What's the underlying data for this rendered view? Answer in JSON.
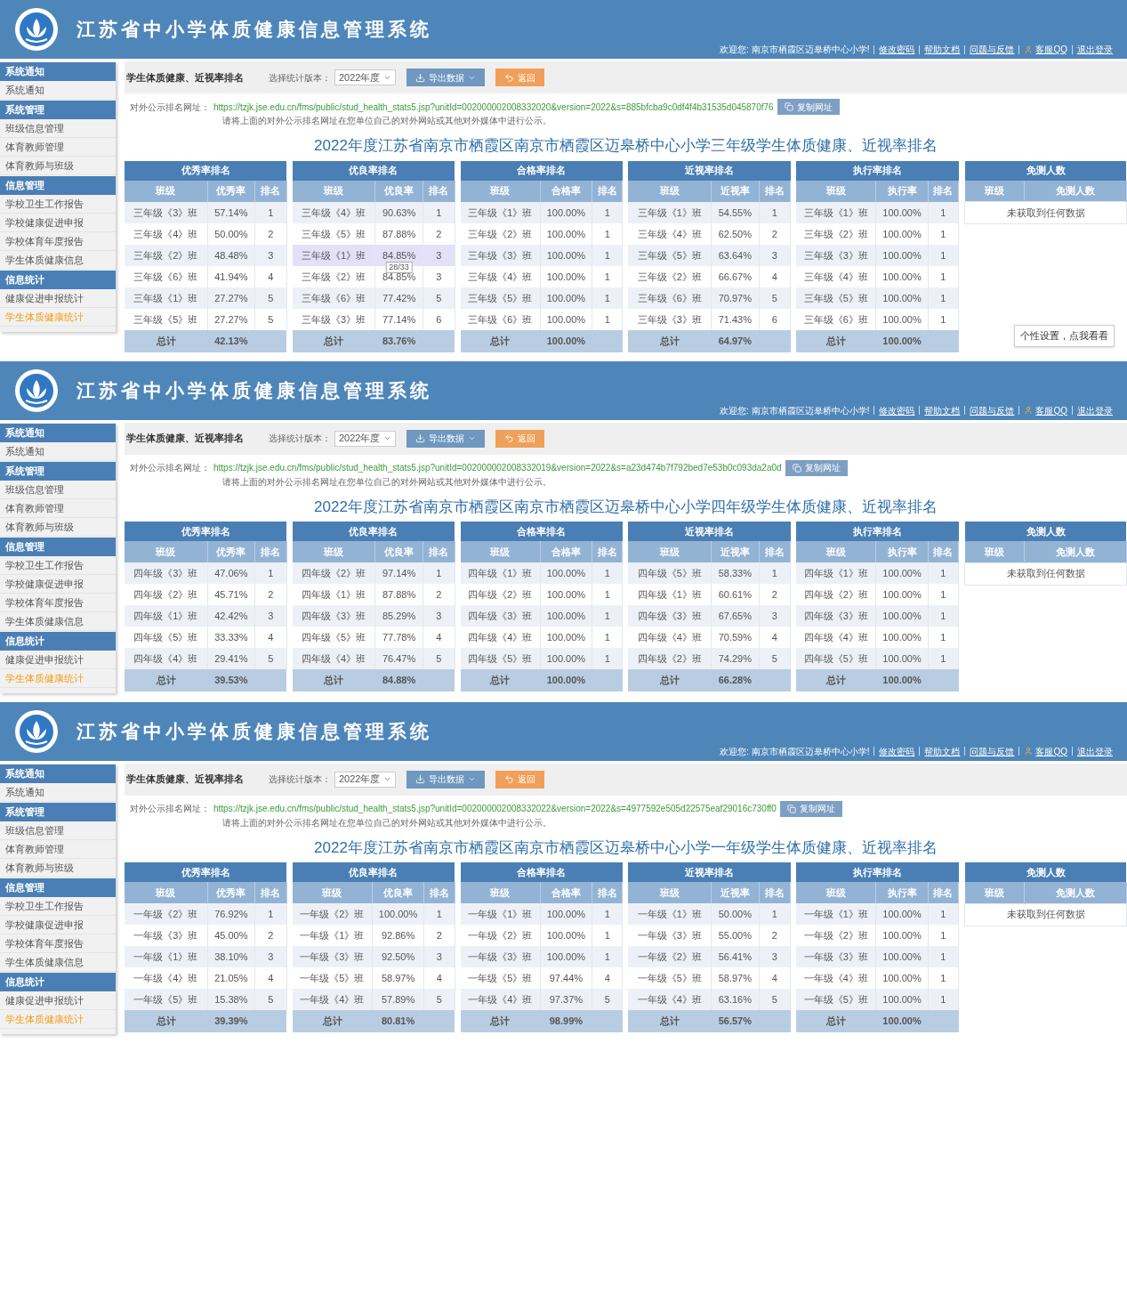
{
  "screens": [
    {
      "header": {
        "title": "江苏省中小学体质健康信息管理系统",
        "welcome": "欢迎您: 南京市栖霞区迈皋桥中心小学!",
        "links": [
          "修改密码",
          "帮助文档",
          "问题与反馈",
          "客服QQ",
          "退出登录"
        ]
      },
      "sidebar": [
        {
          "label": "系统通知",
          "items": [
            {
              "label": "系统通知",
              "selected": false
            }
          ]
        },
        {
          "label": "系统管理",
          "items": [
            {
              "label": "班级信息管理",
              "selected": false
            },
            {
              "label": "体育教师管理",
              "selected": false
            },
            {
              "label": "体育教师与班级",
              "selected": false
            }
          ]
        },
        {
          "label": "信息管理",
          "items": [
            {
              "label": "学校卫生工作报告",
              "selected": false
            },
            {
              "label": "学校健康促进申报",
              "selected": false
            },
            {
              "label": "学校体育年度报告",
              "selected": false
            },
            {
              "label": "学生体质健康信息",
              "selected": false
            }
          ]
        },
        {
          "label": "信息统计",
          "items": [
            {
              "label": "健康促进申报统计",
              "selected": false
            },
            {
              "label": "学生体质健康统计",
              "selected": true
            }
          ]
        }
      ],
      "toolbar": {
        "title": "学生体质健康、近视率排名",
        "version_label": "选择统计版本：",
        "version": "2022年度",
        "buttons": [
          {
            "kind": "export",
            "label": "导出数据"
          },
          {
            "kind": "back",
            "label": "返回"
          }
        ]
      },
      "url_label": "对外公示排名网址：",
      "url": "https://tzjk.jse.edu.cn/fms/public/stud_health_stats5.jsp?unitId=002000002008332020&version=2022&s=885bfcba9c0df4f4b31535d045870f76",
      "copy_button": "复制网址",
      "note": "请将上面的对外公示排名网址在您单位自己的对外网站或其他对外媒体中进行公示。",
      "heading": "2022年度江苏省南京市栖霞区南京市栖霞区迈皋桥中心小学三年级学生体质健康、近视率排名",
      "tables": [
        {
          "title": "优秀率排名",
          "columns": [
            "班级",
            "优秀率",
            "排名"
          ],
          "rows": [
            {
              "cells": [
                "三年级《3》班",
                "57.14%",
                "1"
              ],
              "hovered": false
            },
            {
              "cells": [
                "三年级《4》班",
                "50.00%",
                "2"
              ],
              "hovered": false
            },
            {
              "cells": [
                "三年级《2》班",
                "48.48%",
                "3"
              ],
              "hovered": false
            },
            {
              "cells": [
                "三年级《6》班",
                "41.94%",
                "4"
              ],
              "hovered": false
            },
            {
              "cells": [
                "三年级《1》班",
                "27.27%",
                "5"
              ],
              "hovered": false
            },
            {
              "cells": [
                "三年级《5》班",
                "27.27%",
                "5"
              ],
              "hovered": false
            }
          ],
          "total": [
            "总计",
            "42.13%"
          ]
        },
        {
          "title": "优良率排名",
          "columns": [
            "班级",
            "优良率",
            "排名"
          ],
          "rows": [
            {
              "cells": [
                "三年级《4》班",
                "90.63%",
                "1"
              ],
              "hovered": false
            },
            {
              "cells": [
                "三年级《5》班",
                "87.88%",
                "2"
              ],
              "hovered": false
            },
            {
              "cells": [
                "三年级《1》班",
                "84.85%",
                "3"
              ],
              "hovered": true,
              "tooltip": "28/33"
            },
            {
              "cells": [
                "三年级《2》班",
                "84.85%",
                "3"
              ],
              "hovered": false
            },
            {
              "cells": [
                "三年级《6》班",
                "77.42%",
                "5"
              ],
              "hovered": false
            },
            {
              "cells": [
                "三年级《3》班",
                "77.14%",
                "6"
              ],
              "hovered": false
            }
          ],
          "total": [
            "总计",
            "83.76%"
          ]
        },
        {
          "title": "合格率排名",
          "columns": [
            "班级",
            "合格率",
            "排名"
          ],
          "rows": [
            {
              "cells": [
                "三年级《1》班",
                "100.00%",
                "1"
              ],
              "hovered": false
            },
            {
              "cells": [
                "三年级《2》班",
                "100.00%",
                "1"
              ],
              "hovered": false
            },
            {
              "cells": [
                "三年级《3》班",
                "100.00%",
                "1"
              ],
              "hovered": false
            },
            {
              "cells": [
                "三年级《4》班",
                "100.00%",
                "1"
              ],
              "hovered": false
            },
            {
              "cells": [
                "三年级《5》班",
                "100.00%",
                "1"
              ],
              "hovered": false
            },
            {
              "cells": [
                "三年级《6》班",
                "100.00%",
                "1"
              ],
              "hovered": false
            }
          ],
          "total": [
            "总计",
            "100.00%"
          ]
        },
        {
          "title": "近视率排名",
          "columns": [
            "班级",
            "近视率",
            "排名"
          ],
          "rows": [
            {
              "cells": [
                "三年级《1》班",
                "54.55%",
                "1"
              ],
              "hovered": false
            },
            {
              "cells": [
                "三年级《4》班",
                "62.50%",
                "2"
              ],
              "hovered": false
            },
            {
              "cells": [
                "三年级《5》班",
                "63.64%",
                "3"
              ],
              "hovered": false
            },
            {
              "cells": [
                "三年级《2》班",
                "66.67%",
                "4"
              ],
              "hovered": false
            },
            {
              "cells": [
                "三年级《6》班",
                "70.97%",
                "5"
              ],
              "hovered": false
            },
            {
              "cells": [
                "三年级《3》班",
                "71.43%",
                "6"
              ],
              "hovered": false
            }
          ],
          "total": [
            "总计",
            "64.97%"
          ]
        },
        {
          "title": "执行率排名",
          "columns": [
            "班级",
            "执行率",
            "排名"
          ],
          "rows": [
            {
              "cells": [
                "三年级《1》班",
                "100.00%",
                "1"
              ],
              "hovered": false
            },
            {
              "cells": [
                "三年级《2》班",
                "100.00%",
                "1"
              ],
              "hovered": false
            },
            {
              "cells": [
                "三年级《3》班",
                "100.00%",
                "1"
              ],
              "hovered": false
            },
            {
              "cells": [
                "三年级《4》班",
                "100.00%",
                "1"
              ],
              "hovered": false
            },
            {
              "cells": [
                "三年级《5》班",
                "100.00%",
                "1"
              ],
              "hovered": false
            },
            {
              "cells": [
                "三年级《6》班",
                "100.00%",
                "1"
              ],
              "hovered": false
            }
          ],
          "total": [
            "总计",
            "100.00%"
          ]
        },
        {
          "title": "免测人数",
          "columns": [
            "班级",
            "免测人数"
          ],
          "empty_text": "未获取到任何数据"
        }
      ],
      "floating_tip": "个性设置，点我看看"
    },
    {
      "header": {
        "title": "江苏省中小学体质健康信息管理系统",
        "welcome": "欢迎您: 南京市栖霞区迈皋桥中心小学!",
        "links": [
          "修改密码",
          "帮助文档",
          "问题与反馈",
          "客服QQ",
          "退出登录"
        ]
      },
      "sidebar": [
        {
          "label": "系统通知",
          "items": [
            {
              "label": "系统通知",
              "selected": false
            }
          ]
        },
        {
          "label": "系统管理",
          "items": [
            {
              "label": "班级信息管理",
              "selected": false
            },
            {
              "label": "体育教师管理",
              "selected": false
            },
            {
              "label": "体育教师与班级",
              "selected": false
            }
          ]
        },
        {
          "label": "信息管理",
          "items": [
            {
              "label": "学校卫生工作报告",
              "selected": false
            },
            {
              "label": "学校健康促进申报",
              "selected": false
            },
            {
              "label": "学校体育年度报告",
              "selected": false
            },
            {
              "label": "学生体质健康信息",
              "selected": false
            }
          ]
        },
        {
          "label": "信息统计",
          "items": [
            {
              "label": "健康促进申报统计",
              "selected": false
            },
            {
              "label": "学生体质健康统计",
              "selected": true
            }
          ]
        }
      ],
      "toolbar": {
        "title": "学生体质健康、近视率排名",
        "version_label": "选择统计版本：",
        "version": "2022年度",
        "buttons": [
          {
            "kind": "export",
            "label": "导出数据"
          },
          {
            "kind": "back",
            "label": "返回"
          }
        ]
      },
      "url_label": "对外公示排名网址：",
      "url": "https://tzjk.jse.edu.cn/fms/public/stud_health_stats5.jsp?unitId=002000002008332019&version=2022&s=a23d474b7f792bed7e53b0c093da2a0d",
      "copy_button": "复制网址",
      "note": "请将上面的对外公示排名网址在您单位自己的对外网站或其他对外媒体中进行公示。",
      "heading": "2022年度江苏省南京市栖霞区南京市栖霞区迈皋桥中心小学四年级学生体质健康、近视率排名",
      "tables": [
        {
          "title": "优秀率排名",
          "columns": [
            "班级",
            "优秀率",
            "排名"
          ],
          "rows": [
            {
              "cells": [
                "四年级《3》班",
                "47.06%",
                "1"
              ],
              "hovered": false
            },
            {
              "cells": [
                "四年级《2》班",
                "45.71%",
                "2"
              ],
              "hovered": false
            },
            {
              "cells": [
                "四年级《1》班",
                "42.42%",
                "3"
              ],
              "hovered": false
            },
            {
              "cells": [
                "四年级《5》班",
                "33.33%",
                "4"
              ],
              "hovered": false
            },
            {
              "cells": [
                "四年级《4》班",
                "29.41%",
                "5"
              ],
              "hovered": false
            }
          ],
          "total": [
            "总计",
            "39.53%"
          ]
        },
        {
          "title": "优良率排名",
          "columns": [
            "班级",
            "优良率",
            "排名"
          ],
          "rows": [
            {
              "cells": [
                "四年级《2》班",
                "97.14%",
                "1"
              ],
              "hovered": false
            },
            {
              "cells": [
                "四年级《1》班",
                "87.88%",
                "2"
              ],
              "hovered": false
            },
            {
              "cells": [
                "四年级《3》班",
                "85.29%",
                "3"
              ],
              "hovered": false
            },
            {
              "cells": [
                "四年级《5》班",
                "77.78%",
                "4"
              ],
              "hovered": false
            },
            {
              "cells": [
                "四年级《4》班",
                "76.47%",
                "5"
              ],
              "hovered": false
            }
          ],
          "total": [
            "总计",
            "84.88%"
          ]
        },
        {
          "title": "合格率排名",
          "columns": [
            "班级",
            "合格率",
            "排名"
          ],
          "rows": [
            {
              "cells": [
                "四年级《1》班",
                "100.00%",
                "1"
              ],
              "hovered": false
            },
            {
              "cells": [
                "四年级《2》班",
                "100.00%",
                "1"
              ],
              "hovered": false
            },
            {
              "cells": [
                "四年级《3》班",
                "100.00%",
                "1"
              ],
              "hovered": false
            },
            {
              "cells": [
                "四年级《4》班",
                "100.00%",
                "1"
              ],
              "hovered": false
            },
            {
              "cells": [
                "四年级《5》班",
                "100.00%",
                "1"
              ],
              "hovered": false
            }
          ],
          "total": [
            "总计",
            "100.00%"
          ]
        },
        {
          "title": "近视率排名",
          "columns": [
            "班级",
            "近视率",
            "排名"
          ],
          "rows": [
            {
              "cells": [
                "四年级《5》班",
                "58.33%",
                "1"
              ],
              "hovered": false
            },
            {
              "cells": [
                "四年级《1》班",
                "60.61%",
                "2"
              ],
              "hovered": false
            },
            {
              "cells": [
                "四年级《3》班",
                "67.65%",
                "3"
              ],
              "hovered": false
            },
            {
              "cells": [
                "四年级《4》班",
                "70.59%",
                "4"
              ],
              "hovered": false
            },
            {
              "cells": [
                "四年级《2》班",
                "74.29%",
                "5"
              ],
              "hovered": false
            }
          ],
          "total": [
            "总计",
            "66.28%"
          ]
        },
        {
          "title": "执行率排名",
          "columns": [
            "班级",
            "执行率",
            "排名"
          ],
          "rows": [
            {
              "cells": [
                "四年级《1》班",
                "100.00%",
                "1"
              ],
              "hovered": false
            },
            {
              "cells": [
                "四年级《2》班",
                "100.00%",
                "1"
              ],
              "hovered": false
            },
            {
              "cells": [
                "四年级《3》班",
                "100.00%",
                "1"
              ],
              "hovered": false
            },
            {
              "cells": [
                "四年级《4》班",
                "100.00%",
                "1"
              ],
              "hovered": false
            },
            {
              "cells": [
                "四年级《5》班",
                "100.00%",
                "1"
              ],
              "hovered": false
            }
          ],
          "total": [
            "总计",
            "100.00%"
          ]
        },
        {
          "title": "免测人数",
          "columns": [
            "班级",
            "免测人数"
          ],
          "empty_text": "未获取到任何数据"
        }
      ]
    },
    {
      "header": {
        "title": "江苏省中小学体质健康信息管理系统",
        "welcome": "欢迎您: 南京市栖霞区迈皋桥中心小学!",
        "links": [
          "修改密码",
          "帮助文档",
          "问题与反馈",
          "客服QQ",
          "退出登录"
        ]
      },
      "sidebar": [
        {
          "label": "系统通知",
          "items": [
            {
              "label": "系统通知",
              "selected": false
            }
          ]
        },
        {
          "label": "系统管理",
          "items": [
            {
              "label": "班级信息管理",
              "selected": false
            },
            {
              "label": "体育教师管理",
              "selected": false
            },
            {
              "label": "体育教师与班级",
              "selected": false
            }
          ]
        },
        {
          "label": "信息管理",
          "items": [
            {
              "label": "学校卫生工作报告",
              "selected": false
            },
            {
              "label": "学校健康促进申报",
              "selected": false
            },
            {
              "label": "学校体育年度报告",
              "selected": false
            },
            {
              "label": "学生体质健康信息",
              "selected": false
            }
          ]
        },
        {
          "label": "信息统计",
          "items": [
            {
              "label": "健康促进申报统计",
              "selected": false
            },
            {
              "label": "学生体质健康统计",
              "selected": true
            }
          ]
        }
      ],
      "toolbar": {
        "title": "学生体质健康、近视率排名",
        "version_label": "选择统计版本：",
        "version": "2022年度",
        "buttons": [
          {
            "kind": "export",
            "label": "导出数据"
          },
          {
            "kind": "back",
            "label": "返回"
          }
        ]
      },
      "url_label": "对外公示排名网址：",
      "url": "https://tzjk.jse.edu.cn/fms/public/stud_health_stats5.jsp?unitId=002000002008332022&version=2022&s=4977592e505d22575eaf29016c730ff0",
      "copy_button": "复制网址",
      "note": "请将上面的对外公示排名网址在您单位自己的对外网站或其他对外媒体中进行公示。",
      "heading": "2022年度江苏省南京市栖霞区南京市栖霞区迈皋桥中心小学一年级学生体质健康、近视率排名",
      "tables": [
        {
          "title": "优秀率排名",
          "columns": [
            "班级",
            "优秀率",
            "排名"
          ],
          "rows": [
            {
              "cells": [
                "一年级《2》班",
                "76.92%",
                "1"
              ],
              "hovered": false
            },
            {
              "cells": [
                "一年级《3》班",
                "45.00%",
                "2"
              ],
              "hovered": false
            },
            {
              "cells": [
                "一年级《1》班",
                "38.10%",
                "3"
              ],
              "hovered": false
            },
            {
              "cells": [
                "一年级《4》班",
                "21.05%",
                "4"
              ],
              "hovered": false
            },
            {
              "cells": [
                "一年级《5》班",
                "15.38%",
                "5"
              ],
              "hovered": false
            }
          ],
          "total": [
            "总计",
            "39.39%"
          ]
        },
        {
          "title": "优良率排名",
          "columns": [
            "班级",
            "优良率",
            "排名"
          ],
          "rows": [
            {
              "cells": [
                "一年级《2》班",
                "100.00%",
                "1"
              ],
              "hovered": false
            },
            {
              "cells": [
                "一年级《1》班",
                "92.86%",
                "2"
              ],
              "hovered": false
            },
            {
              "cells": [
                "一年级《3》班",
                "92.50%",
                "3"
              ],
              "hovered": false
            },
            {
              "cells": [
                "一年级《5》班",
                "58.97%",
                "4"
              ],
              "hovered": false
            },
            {
              "cells": [
                "一年级《4》班",
                "57.89%",
                "5"
              ],
              "hovered": false
            }
          ],
          "total": [
            "总计",
            "80.81%"
          ]
        },
        {
          "title": "合格率排名",
          "columns": [
            "班级",
            "合格率",
            "排名"
          ],
          "rows": [
            {
              "cells": [
                "一年级《1》班",
                "100.00%",
                "1"
              ],
              "hovered": false
            },
            {
              "cells": [
                "一年级《2》班",
                "100.00%",
                "1"
              ],
              "hovered": false
            },
            {
              "cells": [
                "一年级《3》班",
                "100.00%",
                "1"
              ],
              "hovered": false
            },
            {
              "cells": [
                "一年级《5》班",
                "97.44%",
                "4"
              ],
              "hovered": false
            },
            {
              "cells": [
                "一年级《4》班",
                "97.37%",
                "5"
              ],
              "hovered": false
            }
          ],
          "total": [
            "总计",
            "98.99%"
          ]
        },
        {
          "title": "近视率排名",
          "columns": [
            "班级",
            "近视率",
            "排名"
          ],
          "rows": [
            {
              "cells": [
                "一年级《1》班",
                "50.00%",
                "1"
              ],
              "hovered": false
            },
            {
              "cells": [
                "一年级《3》班",
                "55.00%",
                "2"
              ],
              "hovered": false
            },
            {
              "cells": [
                "一年级《2》班",
                "56.41%",
                "3"
              ],
              "hovered": false
            },
            {
              "cells": [
                "一年级《5》班",
                "58.97%",
                "4"
              ],
              "hovered": false
            },
            {
              "cells": [
                "一年级《4》班",
                "63.16%",
                "5"
              ],
              "hovered": false
            }
          ],
          "total": [
            "总计",
            "56.57%"
          ]
        },
        {
          "title": "执行率排名",
          "columns": [
            "班级",
            "执行率",
            "排名"
          ],
          "rows": [
            {
              "cells": [
                "一年级《1》班",
                "100.00%",
                "1"
              ],
              "hovered": false
            },
            {
              "cells": [
                "一年级《2》班",
                "100.00%",
                "1"
              ],
              "hovered": false
            },
            {
              "cells": [
                "一年级《3》班",
                "100.00%",
                "1"
              ],
              "hovered": false
            },
            {
              "cells": [
                "一年级《4》班",
                "100.00%",
                "1"
              ],
              "hovered": false
            },
            {
              "cells": [
                "一年级《5》班",
                "100.00%",
                "1"
              ],
              "hovered": false
            }
          ],
          "total": [
            "总计",
            "100.00%"
          ]
        },
        {
          "title": "免测人数",
          "columns": [
            "班级",
            "免测人数"
          ],
          "empty_text": "未获取到任何数据"
        }
      ]
    }
  ]
}
